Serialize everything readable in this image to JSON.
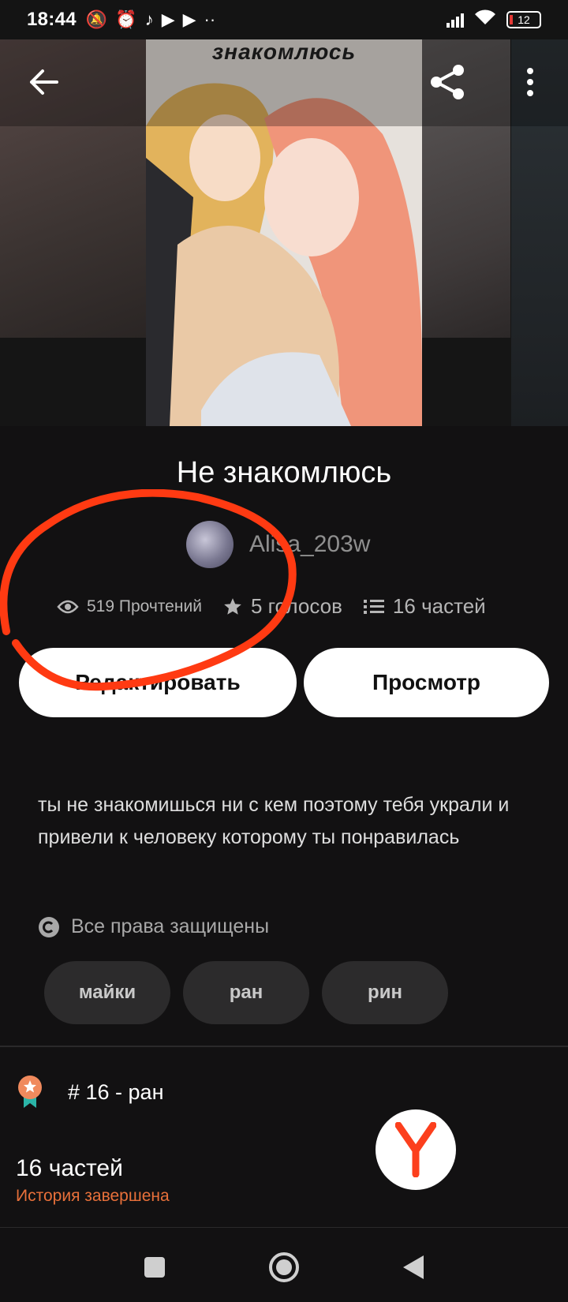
{
  "status_bar": {
    "time": "18:44",
    "battery": "12"
  },
  "cover": {
    "title": "знакомлюсь"
  },
  "story": {
    "title": "Не знакомлюсь",
    "author": "Alisa_203w",
    "reads": "519 Прочтений",
    "votes": "5 голосов",
    "parts": "16 частей"
  },
  "buttons": {
    "edit": "Редактировать",
    "view": "Просмотр"
  },
  "description": "ты не знакомишься ни с кем поэтому тебя украли и привели к человеку которому ты понравилась",
  "rights": "Все права защищены",
  "tags": [
    "майки",
    "ран",
    "рин"
  ],
  "ranking": {
    "text": "# 16 - ран"
  },
  "parts_info": {
    "count": "16 частей",
    "status": "История завершена"
  },
  "colors": {
    "background": "#121112",
    "accent_orange": "#e8703a",
    "annotation_red": "#ff3a12",
    "yandex_red": "#fc3f1d"
  },
  "icons": [
    "back-arrow-icon",
    "share-icon",
    "more-vertical-icon",
    "eye-icon",
    "star-icon",
    "list-icon",
    "copyright-icon",
    "award-ribbon-icon",
    "yandex-icon",
    "nav-recent-icon",
    "nav-home-icon",
    "nav-back-icon"
  ]
}
